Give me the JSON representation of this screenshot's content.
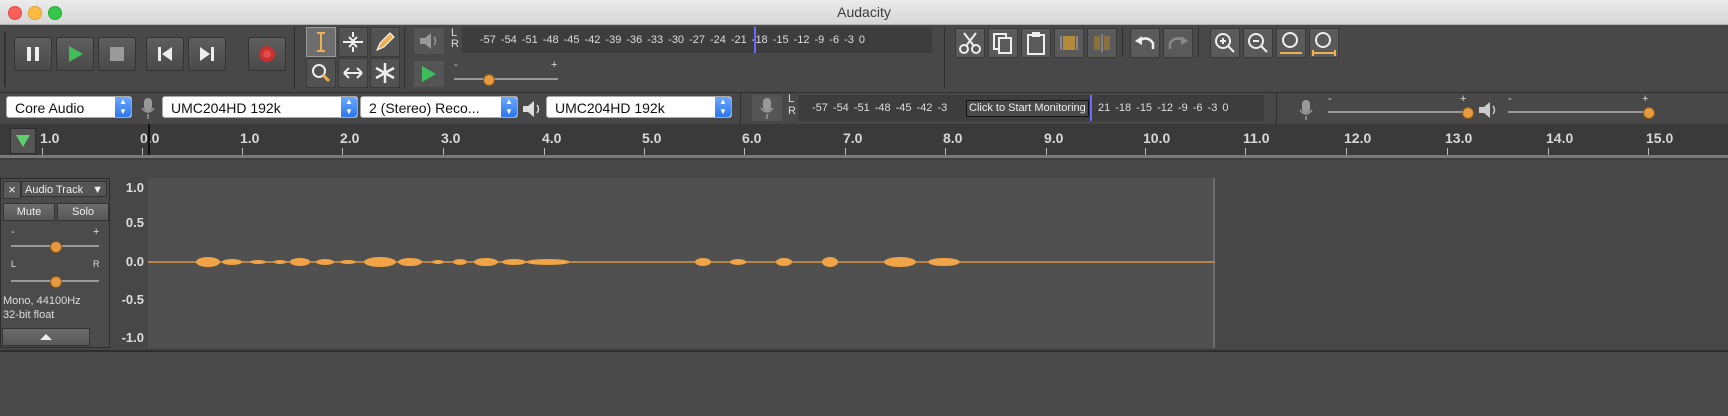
{
  "window": {
    "title": "Audacity"
  },
  "transport": {
    "pause": "pause-icon",
    "play": "play-icon",
    "stop": "stop-icon",
    "skip_start": "skip-to-start-icon",
    "skip_end": "skip-to-end-icon",
    "record": "record-icon"
  },
  "meters": {
    "playback_scale": [
      "-57",
      "-54",
      "-51",
      "-48",
      "-45",
      "-42",
      "-39",
      "-36",
      "-33",
      "-30",
      "-27",
      "-24",
      "-21",
      "-18",
      "-15",
      "-12",
      "-9",
      "-6",
      "-3",
      "0"
    ],
    "record_scale_left": [
      "-57",
      "-54",
      "-51",
      "-48",
      "-45",
      "-42",
      "-3"
    ],
    "record_scale_right": [
      "21",
      "-18",
      "-15",
      "-12",
      "-9",
      "-6",
      "-3",
      "0"
    ],
    "monitor_label": "Click to Start Monitoring",
    "channel_l": "L",
    "channel_r": "R"
  },
  "play_at_speed": {
    "minus": "-",
    "plus": "+"
  },
  "mixer": {
    "rec_minus": "-",
    "rec_plus": "+",
    "play_minus": "-",
    "play_plus": "+"
  },
  "devices": {
    "host": "Core Audio",
    "recording_device": "UMC204HD 192k",
    "channels": "2 (Stereo) Reco...",
    "playback_device": "UMC204HD 192k"
  },
  "ruler": {
    "labels": [
      "1.0",
      "0.0",
      "1.0",
      "2.0",
      "3.0",
      "4.0",
      "5.0",
      "6.0",
      "7.0",
      "8.0",
      "9.0",
      "10.0",
      "11.0",
      "12.0",
      "13.0",
      "14.0",
      "15.0"
    ]
  },
  "track": {
    "name": "Audio Track",
    "close": "×",
    "mute": "Mute",
    "solo": "Solo",
    "gain_minus": "-",
    "gain_plus": "+",
    "pan_left": "L",
    "pan_right": "R",
    "info_line1": "Mono, 44100Hz",
    "info_line2": "32-bit float",
    "vscale": [
      "1.0",
      "0.5",
      "0.0",
      "-0.5",
      "-1.0"
    ]
  },
  "colors": {
    "waveform": "#f0a445",
    "accent": "#3c82f0",
    "background": "#3f3f3f"
  }
}
